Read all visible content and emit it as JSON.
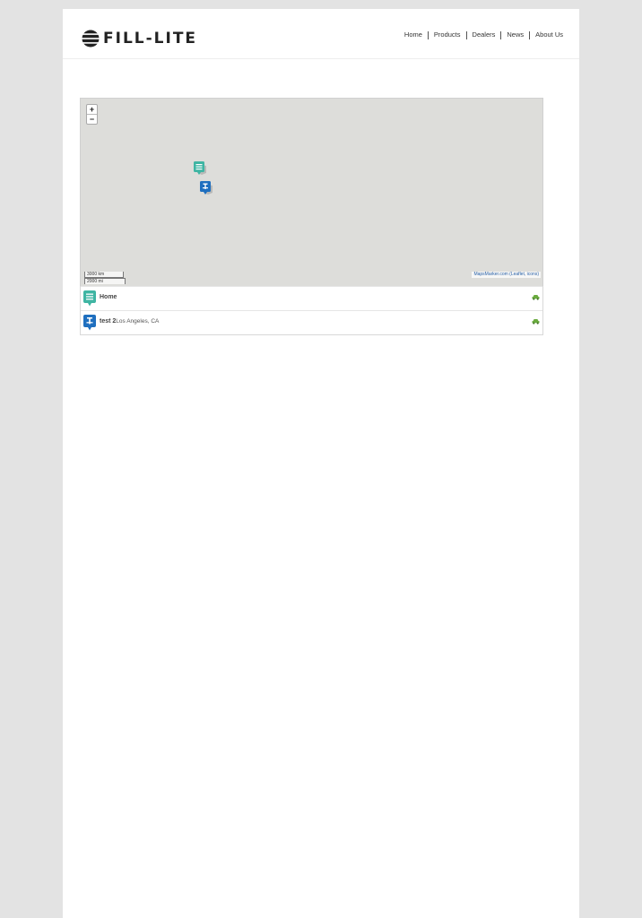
{
  "brand": {
    "name": "FILL-LITE"
  },
  "nav": {
    "items": [
      {
        "label": "Home"
      },
      {
        "label": "Products"
      },
      {
        "label": "Dealers"
      },
      {
        "label": "News"
      },
      {
        "label": "About Us"
      }
    ]
  },
  "map": {
    "zoom_in": "+",
    "zoom_out": "−",
    "scale_km": "3000 km",
    "scale_mi": "2000 mi",
    "attribution": {
      "mapsmarker": "MapsMarker.com",
      "leaflet": "Leaflet",
      "icons": "icons"
    }
  },
  "markers": [
    {
      "title": "Home",
      "address": "",
      "icon": "home-marker-icon",
      "color": "#3fb5a3"
    },
    {
      "title": "test 2",
      "address": "Los Angeles, CA",
      "icon": "pin-marker-icon",
      "color": "#1f6fbf"
    }
  ]
}
